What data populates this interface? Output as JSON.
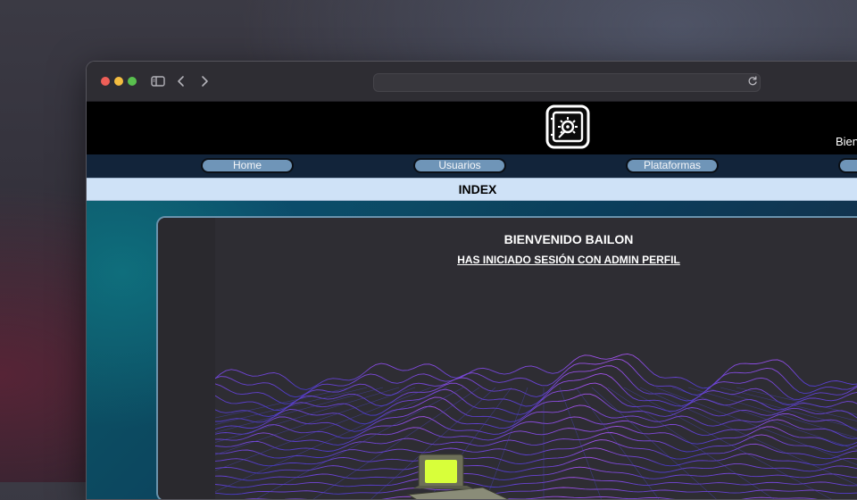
{
  "browser": {
    "url": "",
    "icons": [
      "sidebar-icon",
      "chevron-left-icon",
      "chevron-right-icon",
      "reload-icon"
    ]
  },
  "header": {
    "logo_icon": "vault-icon",
    "welcome_snippet": "Bien"
  },
  "nav": {
    "items": [
      {
        "label": "Home"
      },
      {
        "label": "Usuarios"
      },
      {
        "label": "Plataformas"
      },
      {
        "label": ""
      }
    ]
  },
  "page": {
    "title": "INDEX"
  },
  "main": {
    "welcome": "BIENVENIDO BAILON",
    "profile_text": "HAS INICIADO SESIÓN CON ADMIN PERFIL"
  },
  "colors": {
    "header_bg": "#000000",
    "nav_bg": "#12243a",
    "nav_button": "#6f95b8",
    "index_bar": "#cfe2f7",
    "panel_border": "#6a93ad",
    "wave_purple": "#9b4dff",
    "screen_yellow": "#d8ff3a"
  }
}
